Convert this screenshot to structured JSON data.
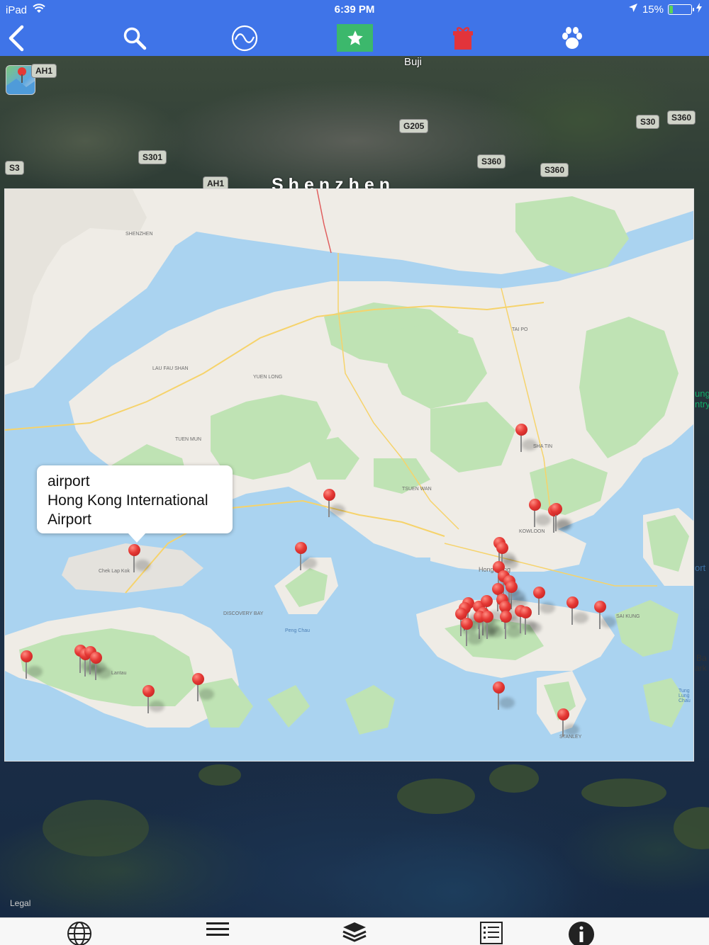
{
  "status_bar": {
    "device": "iPad",
    "time": "6:39 PM",
    "battery_percent": "15%",
    "battery_level": 0.15
  },
  "toolbar": {
    "items": [
      {
        "name": "back",
        "icon": "chevron-left-icon"
      },
      {
        "name": "search",
        "icon": "search-icon"
      },
      {
        "name": "route",
        "icon": "wave-circle-icon"
      },
      {
        "name": "favorites",
        "icon": "star-icon",
        "active": true
      },
      {
        "name": "gift",
        "icon": "gift-icon"
      },
      {
        "name": "pets",
        "icon": "paw-icon"
      }
    ],
    "colors": {
      "background": "#3f74e8",
      "active_bg": "#3cb86c",
      "gift": "#e2343b"
    }
  },
  "satellite": {
    "place_labels": {
      "buji": "Buji",
      "shenzhen": "Shenzhen"
    },
    "road_shields": [
      "AH1",
      "G205",
      "S30",
      "S360",
      "S301",
      "S3",
      "S360",
      "S360",
      "AH1"
    ],
    "legal": "Legal",
    "edge_text": [
      "ung",
      "ntry",
      "ort",
      "Ba",
      "ark"
    ]
  },
  "callout": {
    "title": "airport",
    "subtitle_line1": "Hong Kong International",
    "subtitle_line2": "Airport"
  },
  "tabbar": {
    "items": [
      {
        "name": "globe",
        "icon": "globe-icon"
      },
      {
        "name": "menu",
        "icon": "hamburger-menu-icon"
      },
      {
        "name": "layers",
        "icon": "layers-icon"
      },
      {
        "name": "list",
        "icon": "list-icon"
      },
      {
        "name": "info",
        "icon": "info-icon"
      }
    ]
  },
  "map_labels": {
    "shenzhen": "SHENZHEN",
    "lau_fau_shan": "LAU FAU SHAN",
    "yuen_long": "YUEN LONG",
    "tuen_mun": "TUEN MUN",
    "tai_po": "TAI PO",
    "sha_tin": "SHA TIN",
    "tsuen_wan": "TSUEN WAN",
    "kowloon": "KOWLOON",
    "hong_kong": "Hong Kong",
    "chek_lap_kok": "Chek Lap Kok",
    "lantau": "Lantau",
    "discovery_bay": "DISCOVERY BAY",
    "peng_chau": "Peng Chau",
    "sai_kung": "SAI KUNG",
    "stanley": "STANLEY",
    "tung_lung_chau": "Tung Lung Chau"
  }
}
